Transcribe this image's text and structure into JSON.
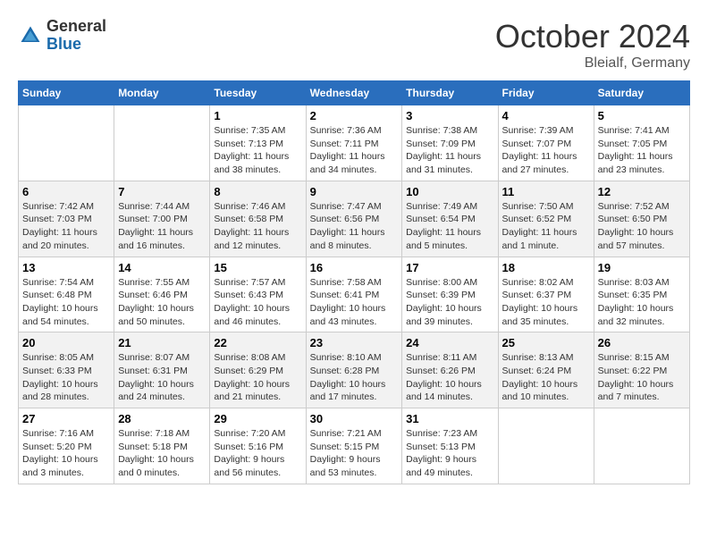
{
  "header": {
    "logo_general": "General",
    "logo_blue": "Blue",
    "month_title": "October 2024",
    "subtitle": "Bleialf, Germany"
  },
  "days_of_week": [
    "Sunday",
    "Monday",
    "Tuesday",
    "Wednesday",
    "Thursday",
    "Friday",
    "Saturday"
  ],
  "weeks": [
    [
      {
        "day": "",
        "info": ""
      },
      {
        "day": "",
        "info": ""
      },
      {
        "day": "1",
        "info": "Sunrise: 7:35 AM\nSunset: 7:13 PM\nDaylight: 11 hours and 38 minutes."
      },
      {
        "day": "2",
        "info": "Sunrise: 7:36 AM\nSunset: 7:11 PM\nDaylight: 11 hours and 34 minutes."
      },
      {
        "day": "3",
        "info": "Sunrise: 7:38 AM\nSunset: 7:09 PM\nDaylight: 11 hours and 31 minutes."
      },
      {
        "day": "4",
        "info": "Sunrise: 7:39 AM\nSunset: 7:07 PM\nDaylight: 11 hours and 27 minutes."
      },
      {
        "day": "5",
        "info": "Sunrise: 7:41 AM\nSunset: 7:05 PM\nDaylight: 11 hours and 23 minutes."
      }
    ],
    [
      {
        "day": "6",
        "info": "Sunrise: 7:42 AM\nSunset: 7:03 PM\nDaylight: 11 hours and 20 minutes."
      },
      {
        "day": "7",
        "info": "Sunrise: 7:44 AM\nSunset: 7:00 PM\nDaylight: 11 hours and 16 minutes."
      },
      {
        "day": "8",
        "info": "Sunrise: 7:46 AM\nSunset: 6:58 PM\nDaylight: 11 hours and 12 minutes."
      },
      {
        "day": "9",
        "info": "Sunrise: 7:47 AM\nSunset: 6:56 PM\nDaylight: 11 hours and 8 minutes."
      },
      {
        "day": "10",
        "info": "Sunrise: 7:49 AM\nSunset: 6:54 PM\nDaylight: 11 hours and 5 minutes."
      },
      {
        "day": "11",
        "info": "Sunrise: 7:50 AM\nSunset: 6:52 PM\nDaylight: 11 hours and 1 minute."
      },
      {
        "day": "12",
        "info": "Sunrise: 7:52 AM\nSunset: 6:50 PM\nDaylight: 10 hours and 57 minutes."
      }
    ],
    [
      {
        "day": "13",
        "info": "Sunrise: 7:54 AM\nSunset: 6:48 PM\nDaylight: 10 hours and 54 minutes."
      },
      {
        "day": "14",
        "info": "Sunrise: 7:55 AM\nSunset: 6:46 PM\nDaylight: 10 hours and 50 minutes."
      },
      {
        "day": "15",
        "info": "Sunrise: 7:57 AM\nSunset: 6:43 PM\nDaylight: 10 hours and 46 minutes."
      },
      {
        "day": "16",
        "info": "Sunrise: 7:58 AM\nSunset: 6:41 PM\nDaylight: 10 hours and 43 minutes."
      },
      {
        "day": "17",
        "info": "Sunrise: 8:00 AM\nSunset: 6:39 PM\nDaylight: 10 hours and 39 minutes."
      },
      {
        "day": "18",
        "info": "Sunrise: 8:02 AM\nSunset: 6:37 PM\nDaylight: 10 hours and 35 minutes."
      },
      {
        "day": "19",
        "info": "Sunrise: 8:03 AM\nSunset: 6:35 PM\nDaylight: 10 hours and 32 minutes."
      }
    ],
    [
      {
        "day": "20",
        "info": "Sunrise: 8:05 AM\nSunset: 6:33 PM\nDaylight: 10 hours and 28 minutes."
      },
      {
        "day": "21",
        "info": "Sunrise: 8:07 AM\nSunset: 6:31 PM\nDaylight: 10 hours and 24 minutes."
      },
      {
        "day": "22",
        "info": "Sunrise: 8:08 AM\nSunset: 6:29 PM\nDaylight: 10 hours and 21 minutes."
      },
      {
        "day": "23",
        "info": "Sunrise: 8:10 AM\nSunset: 6:28 PM\nDaylight: 10 hours and 17 minutes."
      },
      {
        "day": "24",
        "info": "Sunrise: 8:11 AM\nSunset: 6:26 PM\nDaylight: 10 hours and 14 minutes."
      },
      {
        "day": "25",
        "info": "Sunrise: 8:13 AM\nSunset: 6:24 PM\nDaylight: 10 hours and 10 minutes."
      },
      {
        "day": "26",
        "info": "Sunrise: 8:15 AM\nSunset: 6:22 PM\nDaylight: 10 hours and 7 minutes."
      }
    ],
    [
      {
        "day": "27",
        "info": "Sunrise: 7:16 AM\nSunset: 5:20 PM\nDaylight: 10 hours and 3 minutes."
      },
      {
        "day": "28",
        "info": "Sunrise: 7:18 AM\nSunset: 5:18 PM\nDaylight: 10 hours and 0 minutes."
      },
      {
        "day": "29",
        "info": "Sunrise: 7:20 AM\nSunset: 5:16 PM\nDaylight: 9 hours and 56 minutes."
      },
      {
        "day": "30",
        "info": "Sunrise: 7:21 AM\nSunset: 5:15 PM\nDaylight: 9 hours and 53 minutes."
      },
      {
        "day": "31",
        "info": "Sunrise: 7:23 AM\nSunset: 5:13 PM\nDaylight: 9 hours and 49 minutes."
      },
      {
        "day": "",
        "info": ""
      },
      {
        "day": "",
        "info": ""
      }
    ]
  ]
}
